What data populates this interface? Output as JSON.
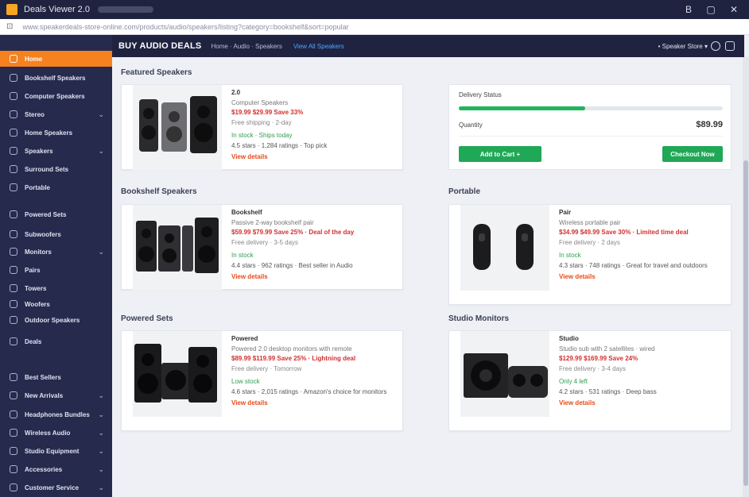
{
  "window": {
    "title": "Deals Viewer 2.0",
    "controls": [
      "B",
      "▢",
      "✕"
    ]
  },
  "address_bar": {
    "url": "www.speakerdeals-store-online.com/products/audio/speakers/listing?category=bookshelf&sort=popular"
  },
  "topbar": {
    "brand": "BUY AUDIO DEALS",
    "crumb": "Home · Audio · Speakers",
    "crumb_link": "View All Speakers",
    "user": "• Speaker Store ▾"
  },
  "sidebar": {
    "items": [
      {
        "label": "Home",
        "chevron": "",
        "active": true
      },
      {
        "label": "Bookshelf Speakers",
        "chevron": ""
      },
      {
        "label": "Computer Speakers",
        "chevron": ""
      },
      {
        "label": "Stereo",
        "chevron": "⌄"
      },
      {
        "label": "Home Speakers",
        "chevron": ""
      },
      {
        "label": "Speakers",
        "chevron": "⌄"
      },
      {
        "label": "Surround Sets",
        "chevron": ""
      },
      {
        "label": "Portable",
        "chevron": ""
      },
      {
        "label": "Powered Sets",
        "chevron": ""
      },
      {
        "label": "Subwoofers",
        "chevron": ""
      },
      {
        "label": "Monitors",
        "chevron": "⌄"
      },
      {
        "label": "Pairs",
        "chevron": ""
      },
      {
        "label": "Towers",
        "chevron": ""
      },
      {
        "label": "Woofers",
        "chevron": ""
      },
      {
        "label": "Outdoor Speakers",
        "chevron": ""
      },
      {
        "label": "Deals",
        "chevron": ""
      },
      {
        "label": "Best Sellers",
        "chevron": ""
      },
      {
        "label": "New Arrivals",
        "chevron": "⌄"
      },
      {
        "label": "Headphones Bundles",
        "chevron": "⌄"
      },
      {
        "label": "Wireless Audio",
        "chevron": "⌄"
      },
      {
        "label": "Studio Equipment",
        "chevron": "⌄"
      },
      {
        "label": "Accessories",
        "chevron": "⌄"
      },
      {
        "label": "Customer Service",
        "chevron": "⌄"
      }
    ]
  },
  "sections": {
    "featured": "Featured Speakers",
    "bookshelf": "Bookshelf Speakers",
    "portable": "Portable",
    "powered": "Powered Sets",
    "studio": "Studio Monitors"
  },
  "cart": {
    "label": "Delivery Status",
    "progress_pct": 48,
    "quantity_label": "Quantity",
    "quantity_value": "$89.99",
    "add_button": "Add to Cart  +",
    "checkout_button": "Checkout Now"
  },
  "products": [
    {
      "name": "2.0",
      "subtitle": "Computer Speakers",
      "price": "$19.99  $29.99  Save 33%",
      "grey": "Free shipping · 2-day",
      "stock": "In stock · Ships today",
      "desc": "4.5 stars · 1,284 ratings · Top pick",
      "link": "View details"
    },
    {
      "name": "Bookshelf",
      "subtitle": "Passive 2-way bookshelf pair",
      "price": "$59.99  $79.99  Save 25% · Deal of the day",
      "grey": "Free delivery · 3-5 days",
      "stock": "In stock",
      "desc": "4.4 stars · 962 ratings · Best seller in Audio",
      "link": "View details"
    },
    {
      "name": "Pair",
      "subtitle": "Wireless portable pair",
      "price": "$34.99  $49.99  Save 30% · Limited time deal",
      "grey": "Free delivery · 2 days",
      "stock": "In stock",
      "desc": "4.3 stars · 748 ratings · Great for travel and outdoors",
      "link": "View details"
    },
    {
      "name": "Powered",
      "subtitle": "Powered 2.0 desktop monitors with remote",
      "price": "$89.99  $119.99  Save 25% · Lightning deal",
      "grey": "Free delivery · Tomorrow",
      "stock": "Low stock",
      "desc": "4.6 stars · 2,015 ratings · Amazon's choice for monitors",
      "link": "View details"
    },
    {
      "name": "Studio",
      "subtitle": "Studio sub with 2 satellites · wired",
      "price": "$129.99  $169.99  Save 24%",
      "grey": "Free delivery · 3-4 days",
      "stock": "Only 4 left",
      "desc": "4.2 stars · 531 ratings · Deep bass",
      "link": "View details"
    }
  ]
}
